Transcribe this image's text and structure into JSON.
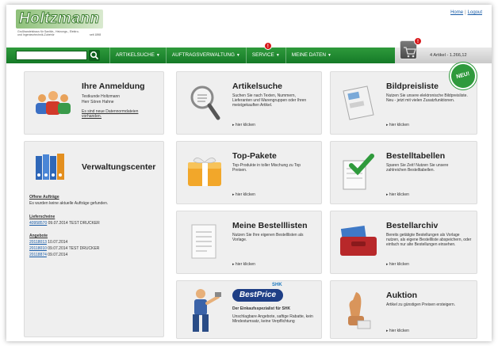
{
  "brand": {
    "logo_text": "Holtzmann",
    "tagline": "Großhandelshaus für Sanitär-, Heizungs-, Elektro- und Ingenieurtechnik-Zubehör",
    "year": "seit 1898"
  },
  "toplinks": {
    "home": "Home",
    "separator": "|",
    "logout": "Logout"
  },
  "nav": {
    "search_placeholder": "",
    "items": [
      {
        "label": "ARTIKELSUCHE",
        "caret": "▼"
      },
      {
        "label": "AUFTRAGSVERWALTUNG",
        "caret": "▼"
      },
      {
        "label": "SERVICE",
        "caret": "▼",
        "badge": "!"
      },
      {
        "label": "MEINE DATEN",
        "caret": "▼"
      }
    ],
    "cart_badge": "!",
    "cart_summary": "4 Artikel - 1.266,12"
  },
  "login": {
    "title": "Ihre Anmeldung",
    "company": "Testkunde Holtzmann",
    "user": "Herr Sören Hahne",
    "notice_link": "Es sind neue Datennormdateien vorhanden."
  },
  "admin": {
    "title": "Verwaltungscenter",
    "open_orders_head": "Offene Aufträge",
    "open_orders_text": "Es wurden keine aktuelle Aufträge gefunden.",
    "delivery_head": "Lieferscheine",
    "deliveries": [
      {
        "number": "40958570",
        "date": "09.07.2014",
        "note": "TEST DRUCKER"
      }
    ],
    "offers_head": "Angebote",
    "offers": [
      {
        "number": "20118013",
        "date": "10.07.2014",
        "note": ""
      },
      {
        "number": "20118010",
        "date": "09.07.2014",
        "note": "TEST DRUCKER"
      },
      {
        "number": "20118874",
        "date": "09.07.2014",
        "note": ""
      }
    ]
  },
  "cards": {
    "artikelsuche": {
      "title": "Artikelsuche",
      "desc": "Suchen Sie nach Texten, Nummern, Lieferanten und Warengruppen oder Ihren meistgekauften Artikel.",
      "link": "▸ hier klicken"
    },
    "bildpreisliste": {
      "title": "Bildpreisliste",
      "desc": "Nutzen Sie unsere elektronische Bildpreisliste. Neu - jetzt mit vielen Zusatzfunktionen.",
      "link": "▸ hier klicken",
      "badge": "NEU!"
    },
    "toppakete": {
      "title": "Top-Pakete",
      "desc": "Top-Produkte in toller Mischung zu Top Preisen.",
      "link": "▸ hier klicken"
    },
    "bestelltabellen": {
      "title": "Bestelltabellen",
      "desc": "Sparen Sie Zeit! Nutzen Sie unsere zahlreichen Bestelltabellen.",
      "link": "▸ hier klicken"
    },
    "bestelllisten": {
      "title": "Meine Bestelllisten",
      "desc": "Nutzen Sie Ihre eigenen Bestelllisten als Vorlage.",
      "link": "▸ hier klicken"
    },
    "bestellarchiv": {
      "title": "Bestellarchiv",
      "desc": "Bereits getätigte Bestellungen als Vorlage nutzen, als eigene Bestellliste abspeichern, oder einfach nur alte Bestellungen einsehen.",
      "link": "▸ hier klicken"
    },
    "bestprice": {
      "logo": "BestPrice",
      "logo_tag": "SHK",
      "subtitle": "Der Einkaufsspezialist für SHK",
      "desc": "Unschlagbare Angebote, saftige Rabatte, kein Mindestumsatz, keine Verpflichtung"
    },
    "auktion": {
      "title": "Auktion",
      "desc": "Artikel zu günstigen Preisen ersteigern.",
      "link": "▸ hier klicken"
    }
  },
  "colors": {
    "nav_green": "#1f8a32",
    "badge_red": "#d8191c",
    "link_blue": "#1a5da8"
  }
}
